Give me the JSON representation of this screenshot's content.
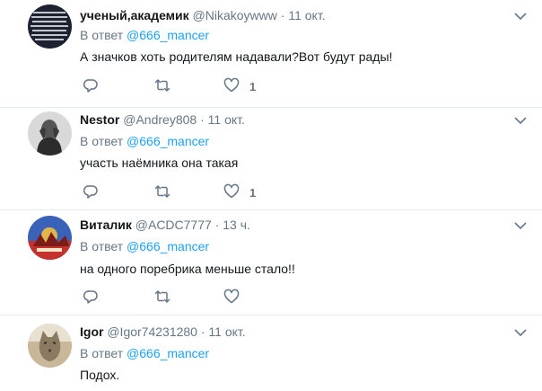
{
  "tweets": [
    {
      "name": "ученый,академик",
      "handle": "@Nikakoywww",
      "time": "11 окт.",
      "reply_prefix": "В ответ",
      "reply_to": "@666_mancer",
      "text": "А значков хоть родителям надавали?Вот будут рады!",
      "likes": "1"
    },
    {
      "name": "Nestor",
      "handle": "@Andrey808",
      "time": "11 окт.",
      "reply_prefix": "В ответ",
      "reply_to": "@666_mancer",
      "text": "участь наёмника она такая",
      "likes": "1"
    },
    {
      "name": "Виталик",
      "handle": "@ACDC7777",
      "time": "13 ч.",
      "reply_prefix": "В ответ",
      "reply_to": "@666_mancer",
      "text": "на одного поребрика меньше стало!!",
      "likes": ""
    },
    {
      "name": "Igor",
      "handle": "@Igor74231280",
      "time": "11 окт.",
      "reply_prefix": "В ответ",
      "reply_to": "@666_mancer",
      "text": "Подох.",
      "likes": ""
    }
  ],
  "dot": "·",
  "icons": [
    "reply-icon",
    "retweet-icon",
    "like-icon",
    "chevron-down-icon"
  ],
  "colors": {
    "link": "#1da1f2",
    "muted": "#657786",
    "text": "#14171a",
    "separator": "#e6ecf0"
  }
}
